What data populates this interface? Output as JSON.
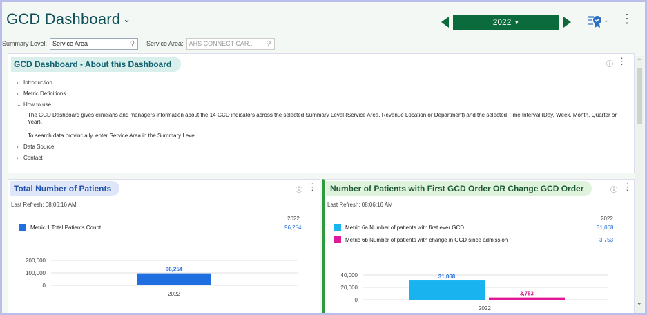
{
  "header": {
    "title": "GCD Dashboard",
    "year": "2022"
  },
  "filters": {
    "summary_level_label": "Summary Level:",
    "summary_level_value": "Service Area",
    "service_area_label": "Service Area:",
    "service_area_value": "AHS CONNECT CAR..."
  },
  "about": {
    "title": "GCD Dashboard - About this Dashboard",
    "sections": [
      "Introduction",
      "Metric Definitions",
      "How to use",
      "Data Source",
      "Contact"
    ],
    "how_to_use_text_1": "The GCD Dashboard gives clinicians and managers information about the 14 GCD indicators across the selected Summary Level (Service Area, Revenue Location or Department) and the selected Time Interval (Day, Week, Month, Quarter or Year).",
    "how_to_use_text_2": "To search data provincially, enter Service Area in the Summary Level."
  },
  "card1": {
    "title": "Total Number of Patients",
    "refresh": "Last Refresh: 08:06:16 AM",
    "year_header": "2022",
    "metrics": [
      {
        "label": "Metric 1 Total Patients Count",
        "value": "96,254",
        "color": "#1f6fe0"
      }
    ]
  },
  "card2": {
    "title": "Number of Patients with First GCD Order OR Change GCD Order",
    "refresh": "Last Refresh: 08:06:16 AM",
    "year_header": "2022",
    "metrics": [
      {
        "label": "Metric 6a Number of patients with first ever GCD",
        "value": "31,068",
        "color": "#19b3ef"
      },
      {
        "label": "Metric 6b Number of patients with change in GCD since admission",
        "value": "3,753",
        "color": "#e0189a"
      }
    ]
  },
  "chart_data": [
    {
      "type": "bar",
      "categories": [
        "2022"
      ],
      "series": [
        {
          "name": "Metric 1 Total Patients Count",
          "values": [
            96254
          ],
          "color": "#1f6fe0"
        }
      ],
      "data_labels": [
        "96,254"
      ],
      "y_ticks": [
        "200,000",
        "100,000",
        "0"
      ],
      "ylim": [
        0,
        200000
      ]
    },
    {
      "type": "bar",
      "categories": [
        "2022"
      ],
      "series": [
        {
          "name": "Metric 6a Number of patients with first ever GCD",
          "values": [
            31068
          ],
          "color": "#19b3ef"
        },
        {
          "name": "Metric 6b Number of patients with change in GCD since admission",
          "values": [
            3753
          ],
          "color": "#e0189a"
        }
      ],
      "data_labels": [
        "31,068",
        "3,753"
      ],
      "y_ticks": [
        "40,000",
        "20,000",
        "0"
      ],
      "ylim": [
        0,
        40000
      ]
    }
  ]
}
